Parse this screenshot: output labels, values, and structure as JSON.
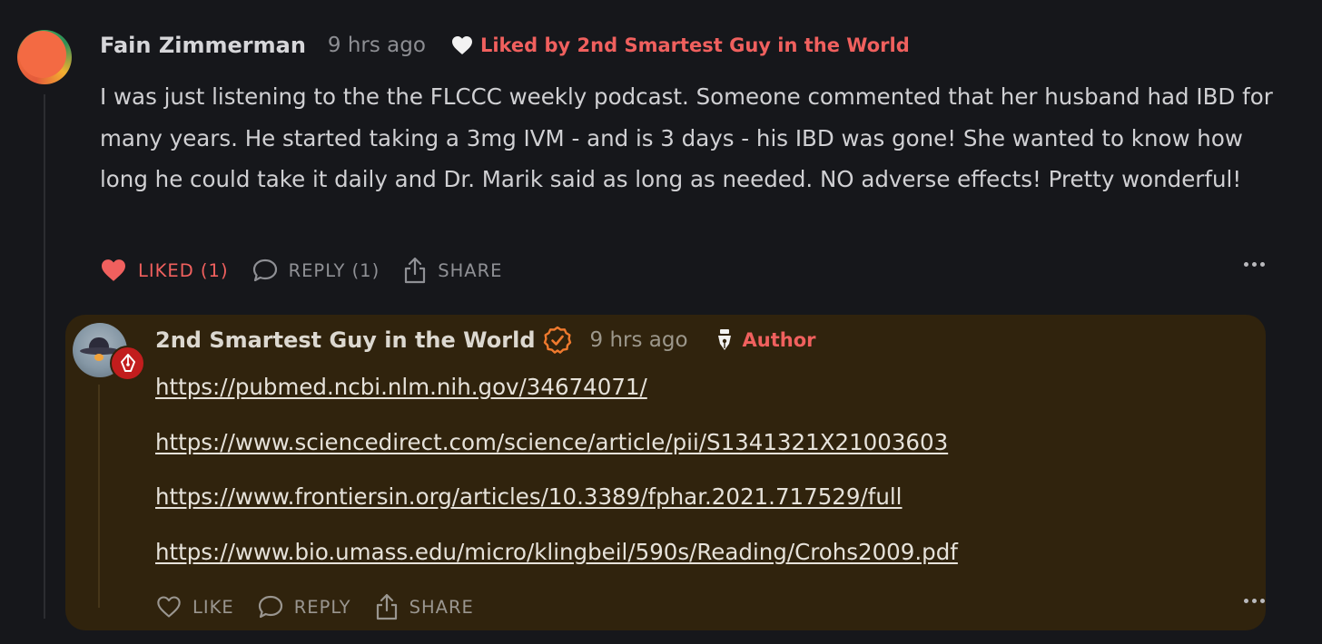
{
  "comment": {
    "author": "Fain Zimmerman",
    "time": "9 hrs ago",
    "liked_by": "Liked by 2nd Smartest Guy in the World",
    "body": "I was just listening to the the FLCCC weekly podcast. Someone commented that her husband had IBD for many years. He started taking a 3mg IVM - and is 3 days - his IBD was gone! She wanted to know how long he could take it daily and Dr. Marik said as long as needed. NO adverse effects! Pretty wonderful!",
    "actions": {
      "like": "LIKED (1)",
      "reply": "REPLY (1)",
      "share": "SHARE"
    },
    "avatar_icon": "avatar-circle"
  },
  "reply": {
    "author": "2nd Smartest Guy in the World",
    "time": "9 hrs ago",
    "role": "Author",
    "links": [
      "https://pubmed.ncbi.nlm.nih.gov/34674071/",
      "https://www.sciencedirect.com/science/article/pii/S1341321X21003603",
      "https://www.frontiersin.org/articles/10.3389/fphar.2021.717529/full",
      "https://www.bio.umass.edu/micro/klingbeil/590s/Reading/Crohs2009.pdf"
    ],
    "actions": {
      "like": "LIKE",
      "reply": "REPLY",
      "share": "SHARE"
    }
  },
  "colors": {
    "background": "#16171b",
    "accent": "#f0605e",
    "reply_background": "#30230d",
    "verified": "#f07a2e"
  }
}
